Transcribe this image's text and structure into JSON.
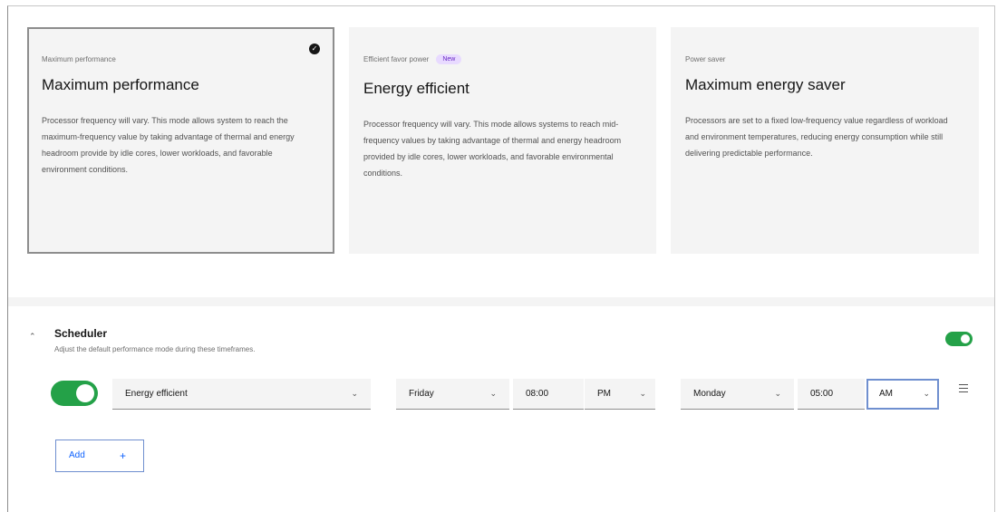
{
  "modes": [
    {
      "eyebrow": "Maximum performance",
      "title": "Maximum performance",
      "description": "Processor frequency will vary. This mode allows system to reach the maximum-frequency value by taking advantage of thermal and energy headroom provide by idle cores, lower workloads, and favorable environment conditions.",
      "selected": true
    },
    {
      "eyebrow": "Efficient favor power",
      "tag": "New",
      "title": "Energy efficient",
      "description": "Processor frequency will vary. This mode allows systems to reach mid-frequency values by taking advantage of thermal and energy headroom provided by idle cores, lower workloads, and favorable environmental conditions.",
      "selected": false
    },
    {
      "eyebrow": "Power saver",
      "title": "Maximum energy saver",
      "description": "Processors are set to a fixed low-frequency value regardless of workload and environment temperatures, reducing energy consumption while still delivering predictable performance.",
      "selected": false
    }
  ],
  "scheduler": {
    "title": "Scheduler",
    "description": "Adjust the default performance mode during these timeframes.",
    "enabled": true,
    "row": {
      "enabled": true,
      "mode": "Energy efficient",
      "start_day": "Friday",
      "start_time": "08:00",
      "start_period": "PM",
      "end_day": "Monday",
      "end_time": "05:00",
      "end_period": "AM"
    },
    "add_label": "Add"
  },
  "icons": {
    "selected": "checkmark-filled-icon",
    "collapse": "chevron-up-icon",
    "dropdown": "chevron-down-icon",
    "row_menu": "overflow-menu-icon",
    "add": "plus-icon"
  },
  "colors": {
    "toggle_on": "#24a148",
    "tag_bg": "#e8daff",
    "tag_text": "#6929c4",
    "focus": "#6f8fcf"
  }
}
